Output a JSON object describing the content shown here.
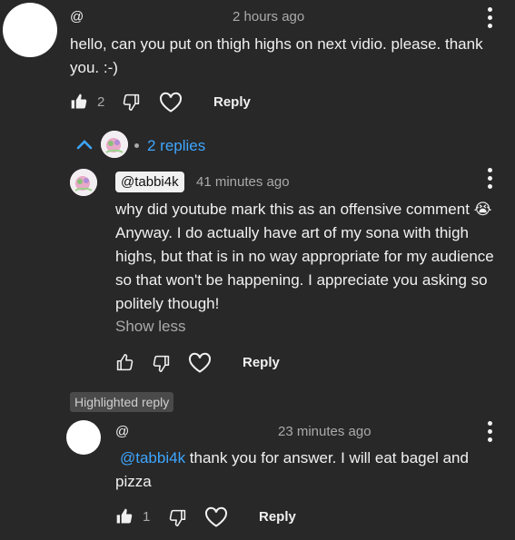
{
  "comment1": {
    "author": "@",
    "time": "2 hours ago",
    "text": "hello,  can you put on thigh highs on next vidio. please. thank you. :-)",
    "likes": "2",
    "reply_label": "Reply",
    "replies_label": "2 replies",
    "icons": {
      "like": "thumbs-up-filled-icon",
      "dislike": "thumbs-down-icon",
      "heart": "heart-outline-icon",
      "more": "more-vertical-icon",
      "toggle": "chevron-up-icon"
    }
  },
  "reply1": {
    "author": "@tabbi4k",
    "time": "41 minutes ago",
    "text": "why did youtube mark this as an offensive comment 😭 Anyway. I do actually have art of my sona with thigh highs, but that is in no way appropriate for my audience so that won't be happening. I appreciate you asking so politely though!",
    "show_less": "Show less",
    "reply_label": "Reply"
  },
  "reply2": {
    "badge": "Highlighted reply",
    "author": "@",
    "time": "23 minutes ago",
    "mention": "@tabbi4k",
    "text": " thank you for answer. I will eat bagel and pizza",
    "likes": "1",
    "reply_label": "Reply"
  },
  "colors": {
    "background": "#282828",
    "link": "#3ea6ff",
    "text": "#f1f1f1",
    "muted": "#aaaaaa"
  }
}
